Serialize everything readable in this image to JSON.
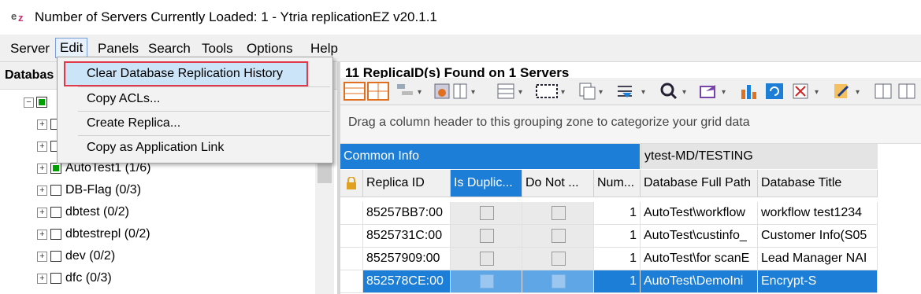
{
  "window": {
    "title": "Number of Servers Currently Loaded: 1 - Ytria replicationEZ v20.1.1",
    "logo": "ez-logo"
  },
  "menubar": {
    "items": [
      "Server",
      "Edit",
      "Panels",
      "Search",
      "Tools",
      "Options",
      "Help"
    ],
    "active": "Edit"
  },
  "edit_menu": {
    "items": [
      "Clear Database Replication History",
      "Copy ACLs...",
      "Create Replica...",
      "Copy as Application Link"
    ],
    "highlighted": "Clear Database Replication History"
  },
  "left_panel": {
    "header": "Databas",
    "tree": [
      {
        "label": "",
        "checked": true
      },
      {
        "label": "",
        "checked": false
      },
      {
        "label": "",
        "checked": false
      },
      {
        "label": "AutoTest1  (1/6)",
        "checked": true
      },
      {
        "label": "DB-Flag  (0/3)",
        "checked": false
      },
      {
        "label": "dbtest  (0/2)",
        "checked": false
      },
      {
        "label": "dbtestrepl  (0/2)",
        "checked": false
      },
      {
        "label": "dev  (0/2)",
        "checked": false
      },
      {
        "label": "dfc  (0/3)",
        "checked": false
      }
    ]
  },
  "right_panel": {
    "found_text": "11 ReplicaID(s) Found on 1 Servers",
    "group_zone_text": "Drag a column header to this grouping zone to categorize your grid data",
    "bands": [
      "Common Info",
      "ytest-MD/TESTING"
    ],
    "columns": [
      "Replica ID",
      "Is Duplic...",
      "Do Not ...",
      "Num...",
      "Database Full Path",
      "Database Title"
    ],
    "rows": [
      {
        "replica_id": "85257BB7:00",
        "num": "1",
        "path": "AutoTest\\workflow",
        "title": "workflow test1234"
      },
      {
        "replica_id": "8525731C:00",
        "num": "1",
        "path": "AutoTest\\custinfo_",
        "title": "Customer Info(S05"
      },
      {
        "replica_id": "85257909:00",
        "num": "1",
        "path": "AutoTest\\for scanE",
        "title": "Lead Manager NAI"
      },
      {
        "replica_id": "852578CE:00",
        "num": "1",
        "path": "AutoTest\\DemoIni",
        "title": "Encrypt-S"
      }
    ],
    "selected_row_index": 3
  },
  "colors": {
    "accent": "#1c7ed6",
    "highlight_border": "#e03a4a",
    "tree_check": "#00a000"
  }
}
